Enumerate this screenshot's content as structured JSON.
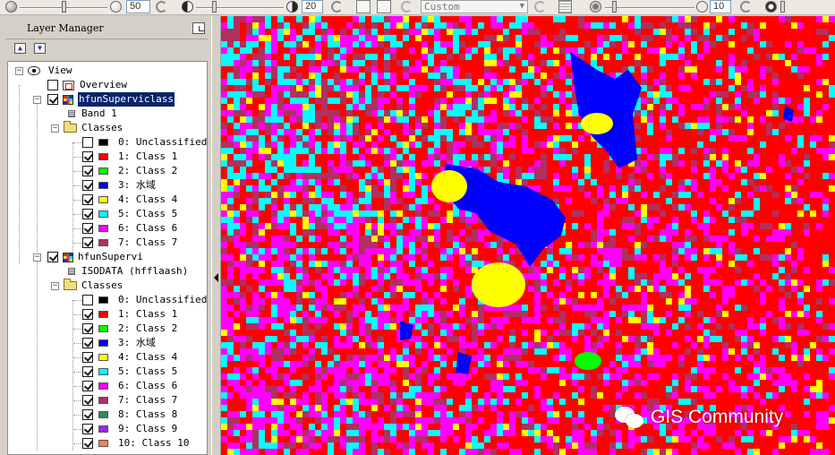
{
  "toolbar": {
    "brightness_value": "50",
    "contrast_value": "20",
    "stretch_combo": "Custom",
    "transparency_value": "10"
  },
  "layer_manager": {
    "title": "Layer Manager",
    "view_label": "View",
    "overview_label": "Overview",
    "layers": [
      {
        "name": "hfunSuperviclass",
        "band_label": "Band 1",
        "classes_label": "Classes",
        "classes": [
          {
            "label": "0: Unclassified",
            "color": "#000000",
            "checked": false
          },
          {
            "label": "1: Class 1",
            "color": "#ff0000",
            "checked": true
          },
          {
            "label": "2: Class 2",
            "color": "#00ff00",
            "checked": true
          },
          {
            "label": "3: 水域",
            "color": "#0000ff",
            "checked": true
          },
          {
            "label": "4: Class 4",
            "color": "#ffff00",
            "checked": true
          },
          {
            "label": "5: Class 5",
            "color": "#00ffff",
            "checked": true
          },
          {
            "label": "6: Class 6",
            "color": "#ff00ff",
            "checked": true
          },
          {
            "label": "7: Class 7",
            "color": "#b03060",
            "checked": true
          }
        ]
      },
      {
        "name": "hfunSupervi",
        "band_label": "ISODATA (hfflaash)",
        "classes_label": "Classes",
        "classes": [
          {
            "label": "0: Unclassified",
            "color": "#000000",
            "checked": false
          },
          {
            "label": "1: Class 1",
            "color": "#ff0000",
            "checked": true
          },
          {
            "label": "2: Class 2",
            "color": "#00ff00",
            "checked": true
          },
          {
            "label": "3: 水域",
            "color": "#0000ff",
            "checked": true
          },
          {
            "label": "4: Class 4",
            "color": "#ffff00",
            "checked": true
          },
          {
            "label": "5: Class 5",
            "color": "#00ffff",
            "checked": true
          },
          {
            "label": "6: Class 6",
            "color": "#ff00ff",
            "checked": true
          },
          {
            "label": "7: Class 7",
            "color": "#b03060",
            "checked": true
          },
          {
            "label": "8: Class 8",
            "color": "#2e8b57",
            "checked": true
          },
          {
            "label": "9: Class 9",
            "color": "#a020f0",
            "checked": true
          },
          {
            "label": "10: Class 10",
            "color": "#ff7f50",
            "checked": true
          }
        ]
      }
    ]
  },
  "map": {
    "palette": [
      "#ff0000",
      "#ff00ff",
      "#00ffff",
      "#b03060",
      "#ffff00",
      "#0000ff",
      "#00ff00"
    ]
  },
  "watermark": {
    "text": "GIS Community"
  }
}
